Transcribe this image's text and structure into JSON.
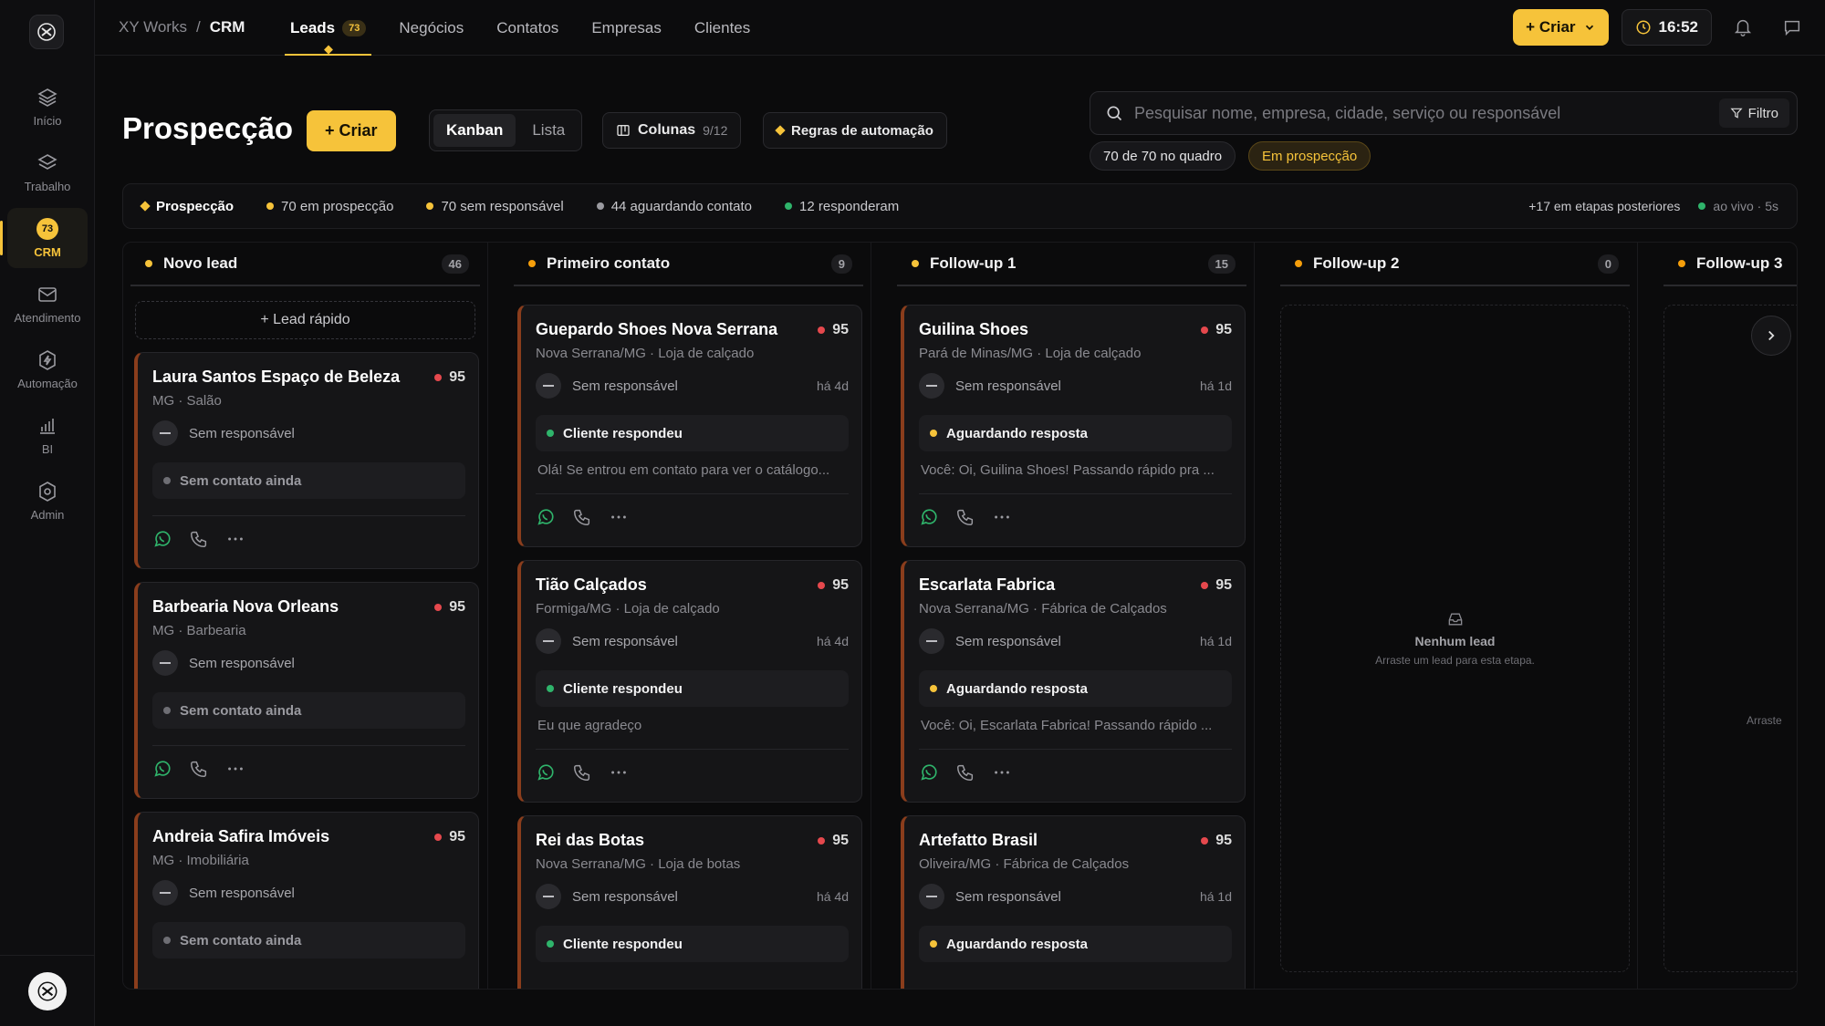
{
  "app": {
    "workspace": "XY Works",
    "section": "CRM",
    "separator": "/"
  },
  "sidebar": {
    "items": [
      {
        "label": "Início",
        "icon": "home-layers-icon"
      },
      {
        "label": "Trabalho",
        "icon": "layers-icon"
      },
      {
        "label": "CRM",
        "icon": "crm-icon",
        "badge": "73",
        "active": true
      },
      {
        "label": "Atendimento",
        "icon": "mail-icon"
      },
      {
        "label": "Automação",
        "icon": "automation-icon"
      },
      {
        "label": "BI",
        "icon": "chart-icon"
      },
      {
        "label": "Admin",
        "icon": "shield-icon"
      }
    ]
  },
  "topbar": {
    "tabs": [
      {
        "label": "Leads",
        "count": "73",
        "active": true
      },
      {
        "label": "Negócios"
      },
      {
        "label": "Contatos"
      },
      {
        "label": "Empresas"
      },
      {
        "label": "Clientes"
      }
    ],
    "create_label": "+ Criar",
    "time": "16:52"
  },
  "page": {
    "title": "Prospecção",
    "create_label": "+ Criar",
    "views": [
      "Kanban",
      "Lista"
    ],
    "active_view": "Kanban",
    "columns_label": "Colunas",
    "columns_count": "9/12",
    "automation_label": "Regras de automação",
    "search_placeholder": "Pesquisar nome, empresa, cidade, serviço ou responsável",
    "filter_label": "Filtro",
    "chips": [
      "70 de 70 no quadro",
      "Em prospecção"
    ]
  },
  "stats": {
    "main": "Prospecção",
    "items": [
      {
        "label": "70 em prospecção",
        "color": "#f6c33a"
      },
      {
        "label": "70 sem responsável",
        "color": "#f6c33a"
      },
      {
        "label": "44 aguardando contato",
        "color": "#9a9aa0"
      },
      {
        "label": "12 responderam",
        "color": "#2fb46b"
      }
    ],
    "later": "+17 em etapas posteriores",
    "live": "ao vivo · 5s"
  },
  "colors": {
    "accent": "#f6c33a",
    "score_red": "#e5484d",
    "green": "#2fb46b",
    "stage_orange": "#f59e0b"
  },
  "columns": [
    {
      "name": "Novo lead",
      "count": "46",
      "quick_add": "+ Lead rápido",
      "cards": [
        {
          "title": "Laura Santos Espaço de Beleza",
          "score": "95",
          "sub": "MG · Salão",
          "owner": "Sem responsável",
          "status": "Sem contato ainda"
        },
        {
          "title": "Barbearia Nova Orleans",
          "score": "95",
          "sub": "MG · Barbearia",
          "owner": "Sem responsável",
          "status": "Sem contato ainda"
        },
        {
          "title": "Andreia Safira Imóveis",
          "score": "95",
          "sub": "MG · Imobiliária",
          "owner": "Sem responsável",
          "status": "Sem contato ainda"
        }
      ]
    },
    {
      "name": "Primeiro contato",
      "count": "9",
      "cards": [
        {
          "title": "Guepardo Shoes Nova Serrana",
          "score": "95",
          "sub": "Nova Serrana/MG · Loja de calçado",
          "owner": "Sem responsável",
          "ago": "há 4d",
          "status": "Cliente respondeu",
          "message": "Olá! Se entrou em contato para ver o catálogo..."
        },
        {
          "title": "Tião Calçados",
          "score": "95",
          "sub": "Formiga/MG · Loja de calçado",
          "owner": "Sem responsável",
          "ago": "há 4d",
          "status": "Cliente respondeu",
          "message": "Eu que agradeço"
        },
        {
          "title": "Rei das Botas",
          "score": "95",
          "sub": "Nova Serrana/MG · Loja de botas",
          "owner": "Sem responsável",
          "ago": "há 4d",
          "status": "Cliente respondeu"
        }
      ]
    },
    {
      "name": "Follow-up 1",
      "count": "15",
      "cards": [
        {
          "title": "Guilina Shoes",
          "score": "95",
          "sub": "Pará de Minas/MG · Loja de calçado",
          "owner": "Sem responsável",
          "ago": "há 1d",
          "status": "Aguardando resposta",
          "message": "Você: Oi, Guilina Shoes! Passando rápido pra ..."
        },
        {
          "title": "Escarlata Fabrica",
          "score": "95",
          "sub": "Nova Serrana/MG · Fábrica de Calçados",
          "owner": "Sem responsável",
          "ago": "há 1d",
          "status": "Aguardando resposta",
          "message": "Você: Oi, Escarlata Fabrica! Passando rápido ..."
        },
        {
          "title": "Artefatto Brasil",
          "score": "95",
          "sub": "Oliveira/MG · Fábrica de Calçados",
          "owner": "Sem responsável",
          "ago": "há 1d",
          "status": "Aguardando resposta"
        }
      ]
    },
    {
      "name": "Follow-up 2",
      "count": "0",
      "empty_title": "Nenhum lead",
      "empty_sub": "Arraste um lead para esta etapa."
    },
    {
      "name": "Follow-up 3",
      "empty_sub_partial": "Arraste"
    }
  ]
}
